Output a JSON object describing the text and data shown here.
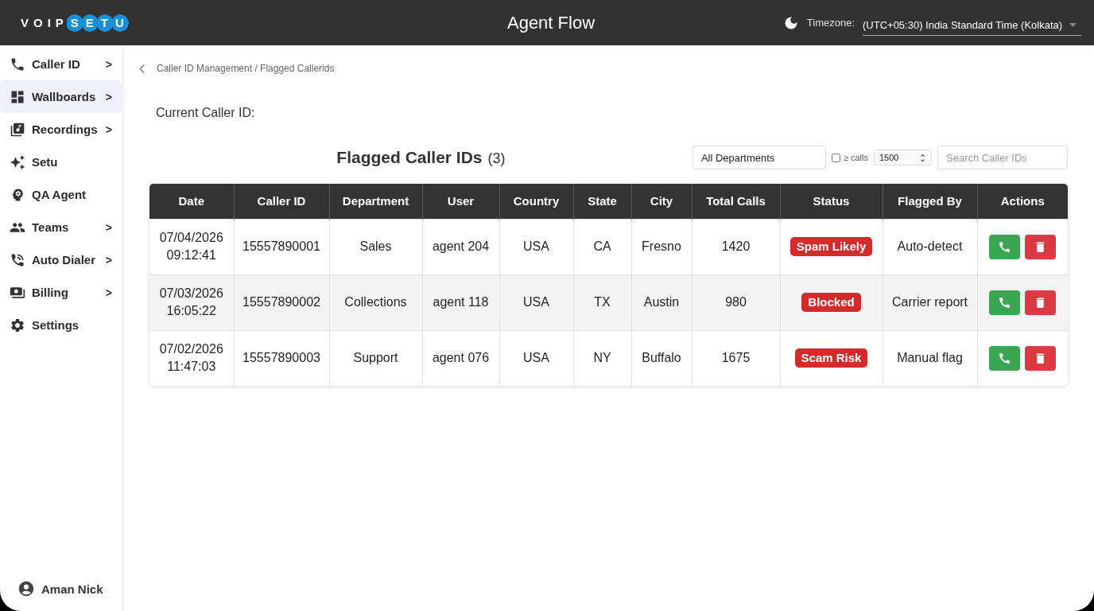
{
  "header": {
    "logo": {
      "plain": "VOIP",
      "circled": "SETU"
    },
    "title": "Agent Flow",
    "timezone": {
      "label": "Timezone:",
      "value": "(UTC+05:30) India Standard Time (Kolkata)"
    }
  },
  "sidebar": {
    "items": [
      {
        "label": "Caller ID",
        "arrow": ">",
        "selected": false
      },
      {
        "label": "Wallboards",
        "arrow": ">",
        "selected": true
      },
      {
        "label": "Recordings",
        "arrow": ">",
        "selected": false
      },
      {
        "label": "Setu",
        "selected": false
      },
      {
        "label": "QA Agent",
        "selected": false
      },
      {
        "label": "Teams",
        "arrow": ">",
        "selected": false
      },
      {
        "label": "Auto Dialer",
        "arrow": ">",
        "selected": false
      },
      {
        "label": "Billing",
        "arrow": ">",
        "selected": false
      },
      {
        "label": "Settings",
        "selected": false
      }
    ],
    "user": {
      "name": "Aman Nick"
    }
  },
  "breadcrumb": "Caller ID Management / Flagged Callerids",
  "current_caller_id": {
    "label": "Current Caller ID:"
  },
  "table_heading": {
    "title": "Flagged Caller IDs",
    "count": "(3)"
  },
  "filters": {
    "department": "All Departments",
    "calls_filter": {
      "checked": false,
      "label": "≥ calls",
      "value": "1500"
    },
    "search": {
      "placeholder": "Search Caller IDs"
    }
  },
  "table": {
    "columns": [
      "Date",
      "Caller ID",
      "Department",
      "User",
      "Country",
      "State",
      "City",
      "Total Calls",
      "Status",
      "Flagged By",
      "Actions"
    ],
    "rows": [
      {
        "date": "07/04/2026 09:12:41",
        "caller_id": "15557890001",
        "department": "Sales",
        "user": "agent 204",
        "country": "USA",
        "state": "CA",
        "city": "Fresno",
        "total_calls": "1420",
        "status": "Spam Likely",
        "flagged_by": "Auto-detect"
      },
      {
        "date": "07/03/2026 16:05:22",
        "caller_id": "15557890002",
        "department": "Collections",
        "user": "agent 118",
        "country": "USA",
        "state": "TX",
        "city": "Austin",
        "total_calls": "980",
        "status": "Blocked",
        "flagged_by": "Carrier report"
      },
      {
        "date": "07/02/2026 11:47:03",
        "caller_id": "15557890003",
        "department": "Support",
        "user": "agent 076",
        "country": "USA",
        "state": "NY",
        "city": "Buffalo",
        "total_calls": "1675",
        "status": "Scam Risk",
        "flagged_by": "Manual flag"
      }
    ]
  }
}
